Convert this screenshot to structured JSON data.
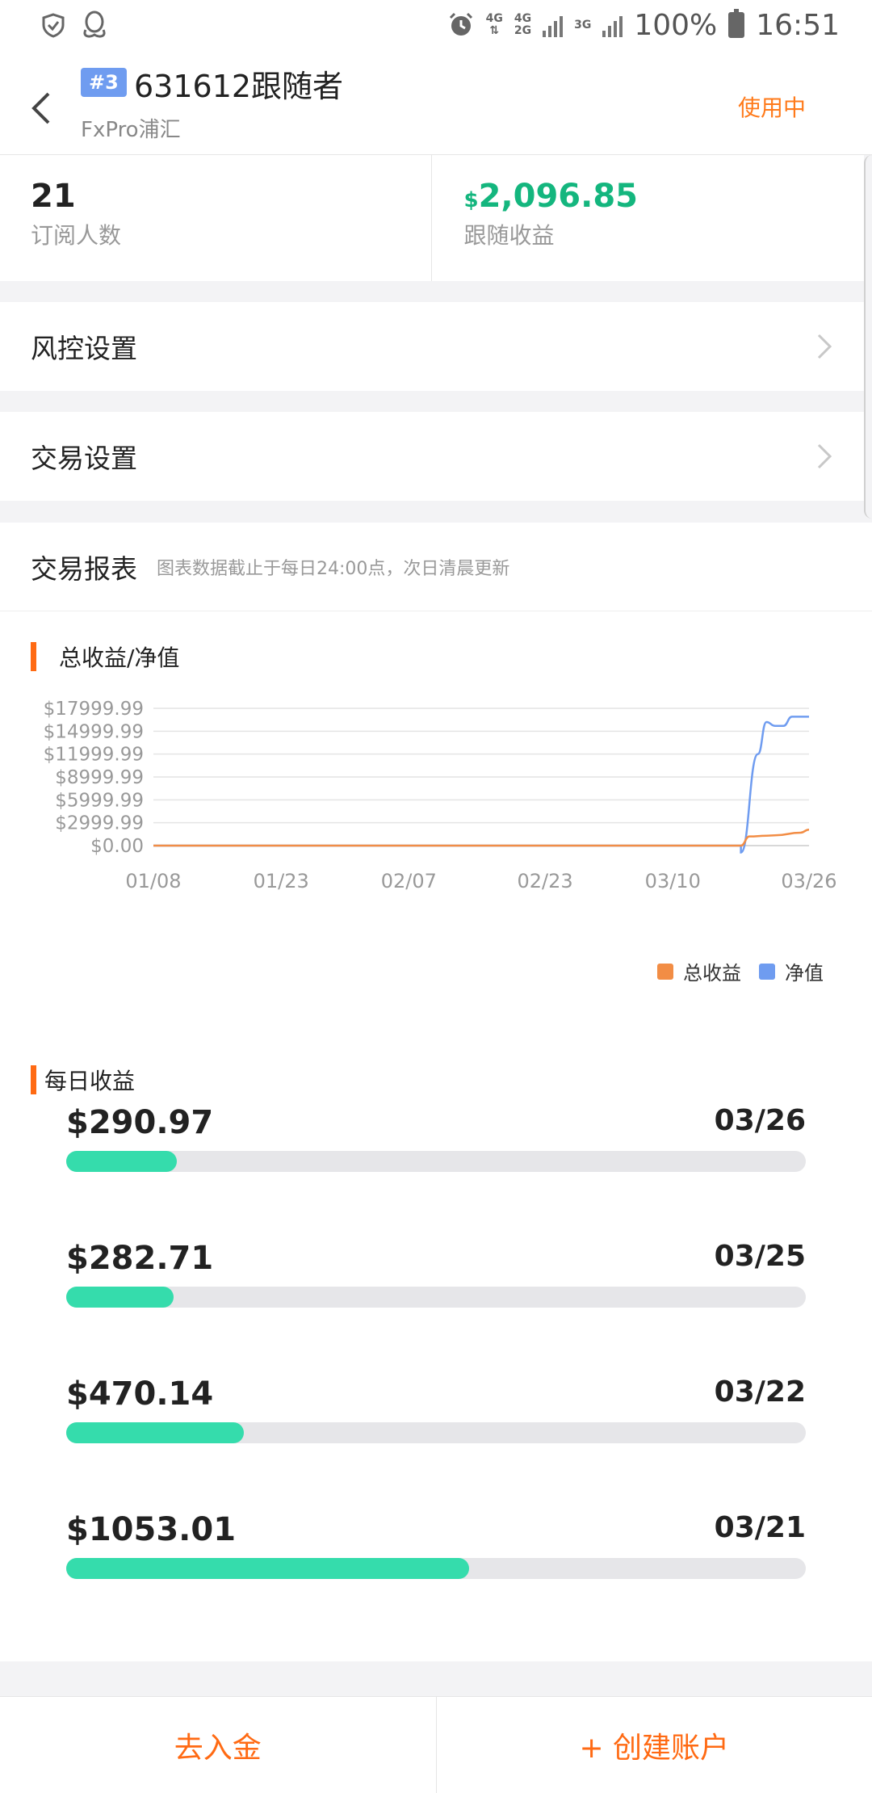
{
  "status_bar": {
    "net_1_top": "4G",
    "net_2_top": "4G",
    "net_2_bottom": "2G",
    "net_3_top": "3G",
    "battery_text": "100%",
    "time": "16:51"
  },
  "header": {
    "rank": "#3",
    "title": "631612跟随者",
    "broker": "FxPro浦汇",
    "status": "使用中"
  },
  "stats": {
    "subscribers_value": "21",
    "subscribers_label": "订阅人数",
    "profit_currency": "$",
    "profit_value": "2,096.85",
    "profit_label": "跟随收益"
  },
  "settings": {
    "risk_label": "风控设置",
    "trade_label": "交易设置"
  },
  "report": {
    "title": "交易报表",
    "note": "图表数据截止于每日24:00点，次日清晨更新",
    "chart_title": "总收益/净值",
    "daily_title": "每日收益"
  },
  "chart_data": {
    "type": "line",
    "title": "总收益/净值",
    "y_ticks": [
      "$17999.99",
      "$14999.99",
      "$11999.99",
      "$8999.99",
      "$5999.99",
      "$2999.99",
      "$0.00"
    ],
    "ylim": [
      0,
      17999.99
    ],
    "x_ticks": [
      "01/08",
      "01/23",
      "02/07",
      "02/23",
      "03/10",
      "03/26"
    ],
    "legend_position": "bottom-right",
    "grid": true,
    "series": [
      {
        "name": "总收益",
        "color": "#f28d45",
        "points": [
          [
            "01/08",
            0
          ],
          [
            "03/18",
            0
          ],
          [
            "03/19",
            1200
          ],
          [
            "03/21",
            1300
          ],
          [
            "03/22",
            1350
          ],
          [
            "03/25",
            1700
          ],
          [
            "03/26",
            2096.85
          ]
        ]
      },
      {
        "name": "净值",
        "color": "#6f9cf0",
        "points": [
          [
            "01/08",
            0
          ],
          [
            "03/18",
            0
          ],
          [
            "03/18",
            -900
          ],
          [
            "03/20",
            12000
          ],
          [
            "03/21",
            16200
          ],
          [
            "03/22",
            15700
          ],
          [
            "03/23",
            15700
          ],
          [
            "03/24",
            16900
          ],
          [
            "03/26",
            16900
          ]
        ]
      }
    ]
  },
  "daily": [
    {
      "amount": "$290.97",
      "date": "03/26",
      "fraction": 0.15
    },
    {
      "amount": "$282.71",
      "date": "03/25",
      "fraction": 0.145
    },
    {
      "amount": "$470.14",
      "date": "03/22",
      "fraction": 0.24
    },
    {
      "amount": "$1053.01",
      "date": "03/21",
      "fraction": 0.545
    }
  ],
  "bottom": {
    "deposit_label": "去入金",
    "create_label": "+ 创建账户"
  },
  "colors": {
    "accent": "#ff6a13",
    "profit_green": "#14b67e",
    "bar_green": "#35dcac",
    "badge_blue": "#6f9cf0"
  }
}
